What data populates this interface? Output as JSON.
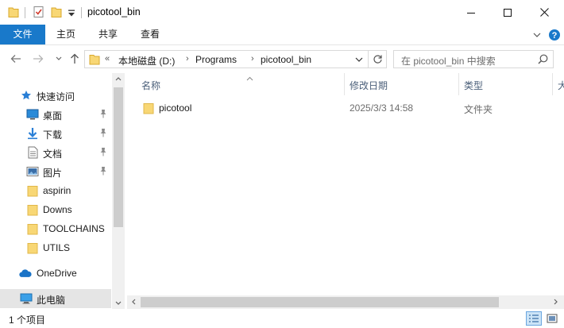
{
  "window": {
    "title": "picotool_bin",
    "controls": {
      "minimize": "—",
      "maximize": "☐",
      "close": "✕"
    }
  },
  "ribbon": {
    "tabs": [
      {
        "label": "文件",
        "active": true
      },
      {
        "label": "主页"
      },
      {
        "label": "共享"
      },
      {
        "label": "查看"
      }
    ],
    "active_color": "#1979ca"
  },
  "address": {
    "overflow": "«",
    "path": [
      "本地磁盘 (D:)",
      "Programs",
      "picotool_bin"
    ],
    "separator": "›"
  },
  "search": {
    "placeholder": "在 picotool_bin 中搜索"
  },
  "sidebar": {
    "items": [
      {
        "label": "快速访问",
        "icon": "star-icon"
      },
      {
        "label": "桌面",
        "icon": "desktop-icon",
        "pinned": true
      },
      {
        "label": "下载",
        "icon": "download-icon",
        "pinned": true
      },
      {
        "label": "文档",
        "icon": "document-icon",
        "pinned": true
      },
      {
        "label": "图片",
        "icon": "picture-icon",
        "pinned": true
      },
      {
        "label": "aspirin",
        "icon": "folder-icon"
      },
      {
        "label": "Downs",
        "icon": "folder-icon"
      },
      {
        "label": "TOOLCHAINS",
        "icon": "folder-icon"
      },
      {
        "label": "UTILS",
        "icon": "folder-icon"
      },
      {
        "label": "OneDrive",
        "icon": "cloud-icon"
      },
      {
        "label": "此电脑",
        "icon": "computer-icon",
        "selected": true
      }
    ]
  },
  "columns": [
    "名称",
    "修改日期",
    "类型",
    "大"
  ],
  "files": [
    {
      "name": "picotool",
      "modified": "2025/3/3 14:58",
      "type": "文件夹"
    }
  ],
  "status": {
    "count": "1 个项目"
  },
  "colors": {
    "folder": "#f8d775",
    "accent": "#1979ca",
    "header_text": "#4c607a"
  }
}
